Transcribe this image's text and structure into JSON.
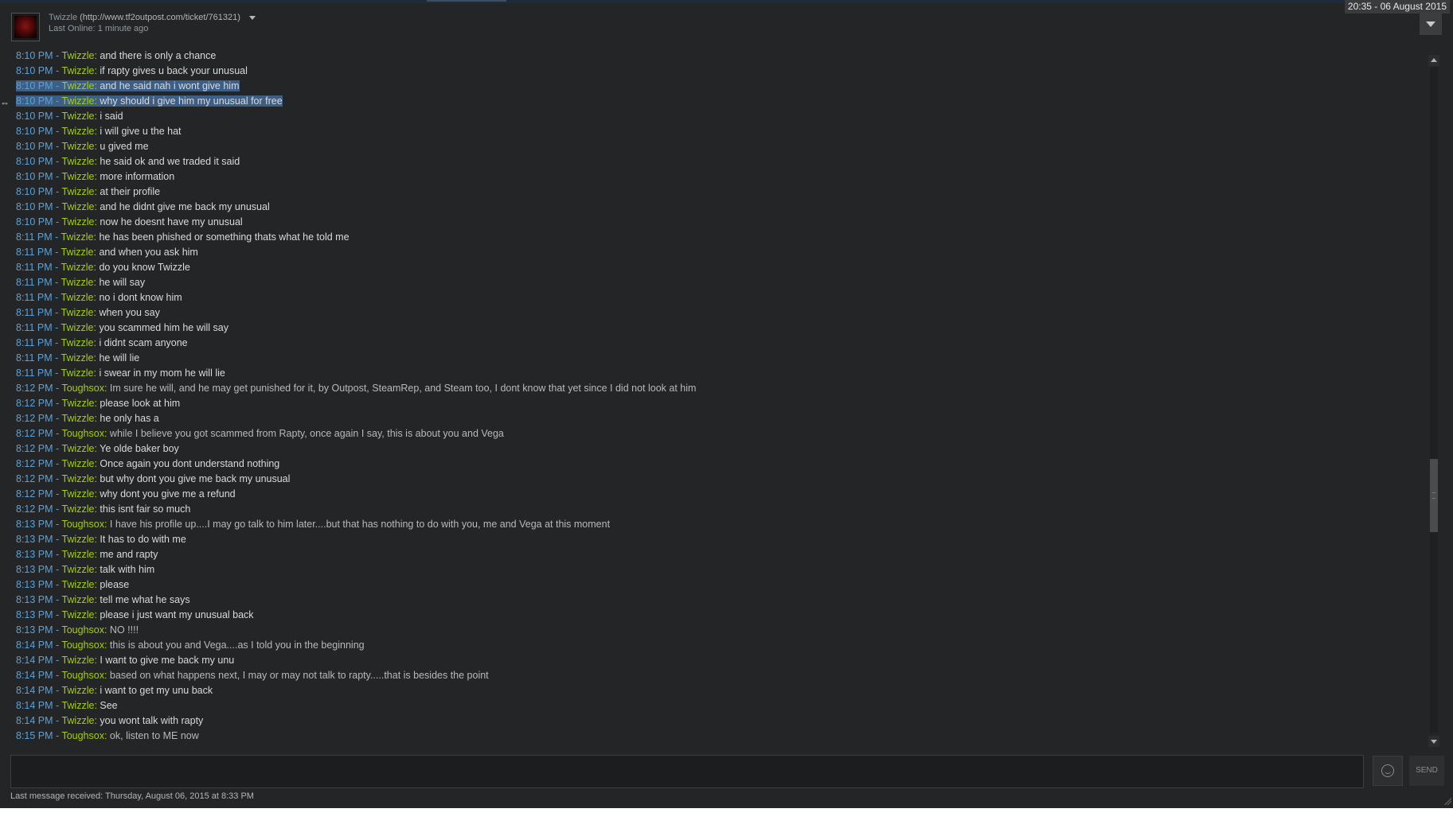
{
  "window": {
    "clock": "20:35 - 06 August 2015"
  },
  "contact": {
    "name": "Twizzle",
    "profile_url": "(http://www.tf2outpost.com/ticket/761321)",
    "status": "Last Online: 1 minute ago"
  },
  "messages": [
    {
      "time": "8:10 PM",
      "sender": "Twizzle",
      "text": "and there is only a chance"
    },
    {
      "time": "8:10 PM",
      "sender": "Twizzle",
      "text": "if rapty gives u back your unusual"
    },
    {
      "time": "8:10 PM",
      "sender": "Twizzle",
      "text": "and he said nah i wont give him",
      "selected": true
    },
    {
      "time": "8:10 PM",
      "sender": "Twizzle",
      "text": "why should i give him my unusual for free",
      "selected": true
    },
    {
      "time": "8:10 PM",
      "sender": "Twizzle",
      "text": "i said"
    },
    {
      "time": "8:10 PM",
      "sender": "Twizzle",
      "text": "i will give u the hat"
    },
    {
      "time": "8:10 PM",
      "sender": "Twizzle",
      "text": "u gived me"
    },
    {
      "time": "8:10 PM",
      "sender": "Twizzle",
      "text": "he said ok and we traded it said"
    },
    {
      "time": "8:10 PM",
      "sender": "Twizzle",
      "text": "more information"
    },
    {
      "time": "8:10 PM",
      "sender": "Twizzle",
      "text": "at their profile"
    },
    {
      "time": "8:10 PM",
      "sender": "Twizzle",
      "text": "and he didnt give me back my unusual"
    },
    {
      "time": "8:10 PM",
      "sender": "Twizzle",
      "text": "now he doesnt have my unusual"
    },
    {
      "time": "8:11 PM",
      "sender": "Twizzle",
      "text": "he has been phished or something thats what he told me"
    },
    {
      "time": "8:11 PM",
      "sender": "Twizzle",
      "text": "and when you ask him"
    },
    {
      "time": "8:11 PM",
      "sender": "Twizzle",
      "text": "do you know Twizzle"
    },
    {
      "time": "8:11 PM",
      "sender": "Twizzle",
      "text": "he will say"
    },
    {
      "time": "8:11 PM",
      "sender": "Twizzle",
      "text": "no i dont know him"
    },
    {
      "time": "8:11 PM",
      "sender": "Twizzle",
      "text": "when you say"
    },
    {
      "time": "8:11 PM",
      "sender": "Twizzle",
      "text": "you scammed him he will say"
    },
    {
      "time": "8:11 PM",
      "sender": "Twizzle",
      "text": "i didnt scam anyone"
    },
    {
      "time": "8:11 PM",
      "sender": "Twizzle",
      "text": "he will lie"
    },
    {
      "time": "8:11 PM",
      "sender": "Twizzle",
      "text": "i swear in my mom he will lie"
    },
    {
      "time": "8:12 PM",
      "sender": "Toughsox",
      "text": "Im sure he will, and he may get punished for it, by Outpost, SteamRep, and Steam too, I dont know that yet since I did not look at him"
    },
    {
      "time": "8:12 PM",
      "sender": "Twizzle",
      "text": "please look at him"
    },
    {
      "time": "8:12 PM",
      "sender": "Twizzle",
      "text": "he only has a"
    },
    {
      "time": "8:12 PM",
      "sender": "Toughsox",
      "text": "while I believe you got scammed from Rapty, once again I say, this is about you and Vega"
    },
    {
      "time": "8:12 PM",
      "sender": "Twizzle",
      "text": "Ye olde baker boy"
    },
    {
      "time": "8:12 PM",
      "sender": "Twizzle",
      "text": "Once again you dont understand nothing"
    },
    {
      "time": "8:12 PM",
      "sender": "Twizzle",
      "text": "but why dont you give me back my unusual"
    },
    {
      "time": "8:12 PM",
      "sender": "Twizzle",
      "text": "why dont you give me a refund"
    },
    {
      "time": "8:12 PM",
      "sender": "Twizzle",
      "text": "this isnt fair so much"
    },
    {
      "time": "8:13 PM",
      "sender": "Toughsox",
      "text": "I have his profile up....I may go talk to him later....but that has nothing to do with you, me and Vega at this moment"
    },
    {
      "time": "8:13 PM",
      "sender": "Twizzle",
      "text": "It has to do with me"
    },
    {
      "time": "8:13 PM",
      "sender": "Twizzle",
      "text": "me and rapty"
    },
    {
      "time": "8:13 PM",
      "sender": "Twizzle",
      "text": "talk with him"
    },
    {
      "time": "8:13 PM",
      "sender": "Twizzle",
      "text": "please"
    },
    {
      "time": "8:13 PM",
      "sender": "Twizzle",
      "text": "tell me what he says"
    },
    {
      "time": "8:13 PM",
      "sender": "Twizzle",
      "text": "please i just want my unusual back"
    },
    {
      "time": "8:13 PM",
      "sender": "Toughsox",
      "text": "NO !!!!"
    },
    {
      "time": "8:14 PM",
      "sender": "Toughsox",
      "text": "this is about you and Vega....as I told you in the beginning"
    },
    {
      "time": "8:14 PM",
      "sender": "Twizzle",
      "text": "I want to give me back my unu"
    },
    {
      "time": "8:14 PM",
      "sender": "Toughsox",
      "text": "based on what happens next, I may or may not talk to rapty.....that is besides the point"
    },
    {
      "time": "8:14 PM",
      "sender": "Twizzle",
      "text": "i want to get my unu back"
    },
    {
      "time": "8:14 PM",
      "sender": "Twizzle",
      "text": "See"
    },
    {
      "time": "8:14 PM",
      "sender": "Twizzle",
      "text": "you wont talk with rapty"
    },
    {
      "time": "8:15 PM",
      "sender": "Toughsox",
      "text": "ok, listen to ME now"
    }
  ],
  "composer": {
    "input_value": "",
    "send_label": "SEND"
  },
  "footer": {
    "last_received": "Last message received: Thursday, August 06, 2015 at 8:33 PM"
  },
  "colors": {
    "time": "#5ba2d8",
    "sender": "#a4d007",
    "background": "#242526",
    "selection": "#3d5f86"
  }
}
